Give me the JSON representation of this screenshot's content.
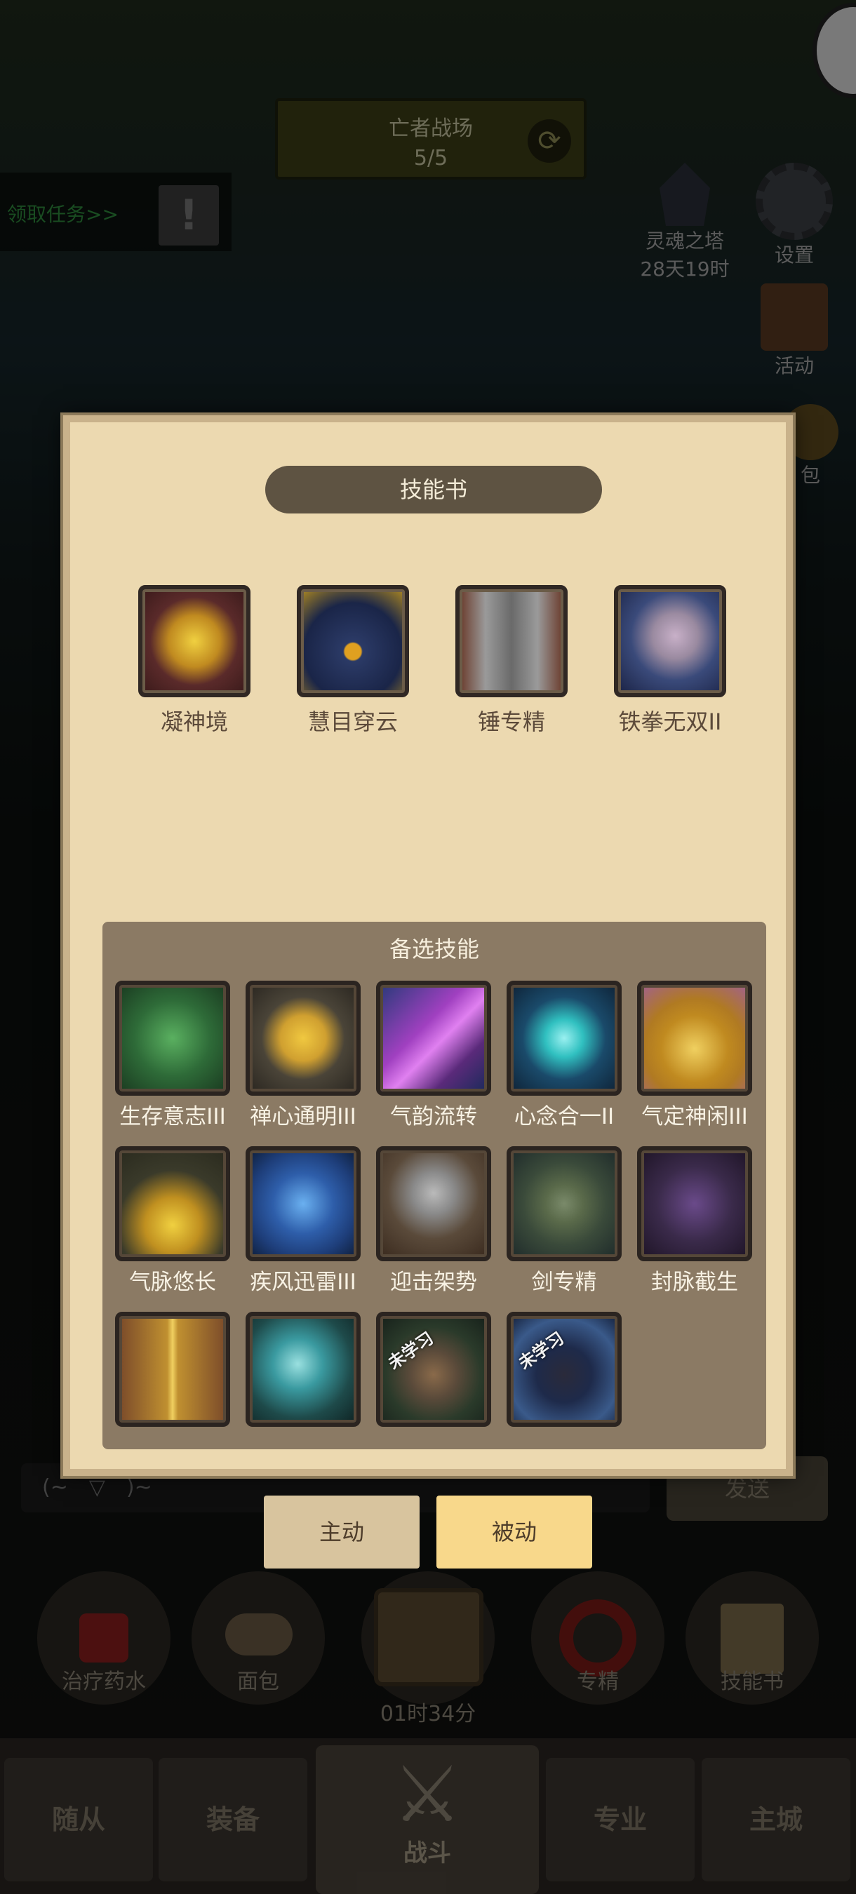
{
  "header": {
    "arena_title": "亡者战场",
    "arena_count": "5/5",
    "task_label": "领取任务>>",
    "tower_label": "灵魂之塔",
    "tower_timer": "28天19时",
    "settings_label": "设置",
    "activity_label": "活动",
    "pack_label": "包"
  },
  "modal": {
    "title": "技能书",
    "equipped": [
      {
        "name": "凝神境",
        "icon": "golden-eye-sigil-icon",
        "color": "#5a2a2a"
      },
      {
        "name": "慧目穿云",
        "icon": "eagle-head-icon",
        "color": "#2b3a66"
      },
      {
        "name": "锤专精",
        "icon": "hammer-icon",
        "color": "#6a3a2a"
      },
      {
        "name": "铁拳无双II",
        "icon": "iron-fist-icon",
        "color": "#3a4a7a"
      }
    ],
    "alternates_title": "备选技能",
    "alternates": [
      {
        "name": "生存意志III",
        "icon": "green-vines-icon",
        "color": "#2e6b38"
      },
      {
        "name": "禅心通明III",
        "icon": "golden-spiral-icon",
        "color": "#4a4438"
      },
      {
        "name": "气韵流转",
        "icon": "purple-swirl-icon",
        "color": "#5a2a7a"
      },
      {
        "name": "心念合一II",
        "icon": "cyan-gem-icon",
        "color": "#1a4a6a"
      },
      {
        "name": "气定神闲III",
        "icon": "golden-armor-icon",
        "color": "#b07a22"
      },
      {
        "name": "气脉悠长",
        "icon": "golden-knot-icon",
        "color": "#3a3a2a"
      },
      {
        "name": "疾风迅雷III",
        "icon": "blue-tree-icon",
        "color": "#1e3e7a"
      },
      {
        "name": "迎击架势",
        "icon": "knight-helmet-icon",
        "color": "#5a4a3a"
      },
      {
        "name": "剑专精",
        "icon": "sword-hilt-icon",
        "color": "#3a4a3a"
      },
      {
        "name": "封脉截生",
        "icon": "chained-figure-icon",
        "color": "#3a2a4a"
      },
      {
        "name": "",
        "icon": "golden-pillar-icon",
        "color": "#7a4a2a"
      },
      {
        "name": "",
        "icon": "water-wave-icon",
        "color": "#1e4a4a"
      },
      {
        "name": "",
        "icon": "stone-hand-icon",
        "color": "#2a3a2a",
        "tag": "未学习"
      },
      {
        "name": "",
        "icon": "dark-figure-icon",
        "color": "#1e2a4a",
        "tag": "未学习"
      }
    ]
  },
  "tabs": {
    "active": "主动",
    "passive": "被动"
  },
  "chat": {
    "placeholder": "(~￣▽￣)~",
    "send": "发送"
  },
  "items": [
    {
      "name": "治疗药水",
      "icon": "potion-icon"
    },
    {
      "name": "面包",
      "icon": "bread-icon"
    },
    {
      "name": "专精",
      "icon": "specialization-icon"
    },
    {
      "name": "技能书",
      "icon": "skill-book-icon"
    }
  ],
  "chest_timer": "01时34分",
  "nav": {
    "followers": "随从",
    "equipment": "装备",
    "battle": "战斗",
    "profession": "专业",
    "main_city": "主城"
  }
}
